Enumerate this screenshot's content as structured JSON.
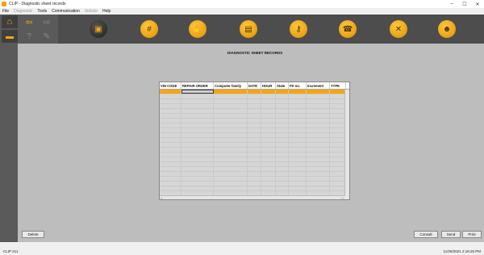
{
  "window": {
    "title": "CLIP - Diagnostic sheet records",
    "minimize": "–",
    "maximize": "☐",
    "close": "✕"
  },
  "menu": [
    "File",
    "Diagnostic",
    "Tools",
    "Communication",
    "Vehicle",
    "Help"
  ],
  "heading": "DIAGNOSTIC SHEET RECORDS",
  "table": {
    "columns": [
      "VIN CODE",
      "REPAIR ORDER",
      "Computer family",
      "DATE",
      "HOUR",
      "State",
      "FD no.",
      "Increment",
      "TYPE"
    ]
  },
  "scroll_left": "<",
  "scroll_right": ">",
  "buttons": {
    "delete": "Delete",
    "consult": "Consult",
    "send": "Send",
    "print": "Print"
  },
  "status": {
    "left": "CLIP 211",
    "right": "11/25/2021 2:16:25 PM"
  }
}
